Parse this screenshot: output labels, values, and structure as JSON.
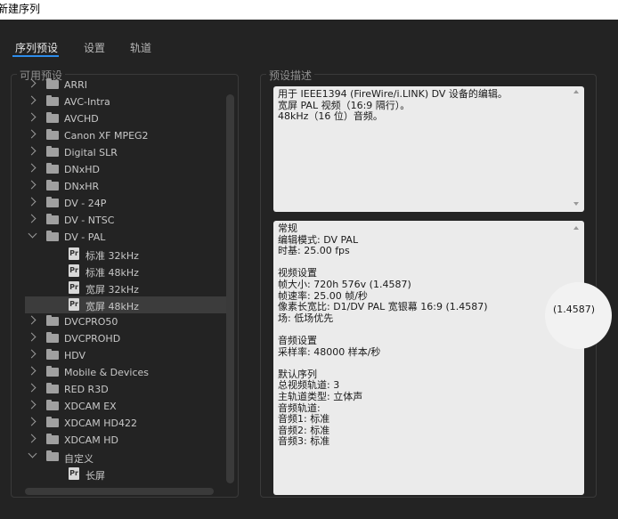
{
  "window": {
    "title": "新建序列"
  },
  "tabs": [
    {
      "label": "序列预设",
      "active": true
    },
    {
      "label": "设置",
      "active": false
    },
    {
      "label": "轨道",
      "active": false
    }
  ],
  "presets_panel": {
    "title": "可用预设",
    "items": [
      {
        "label": "ARRI",
        "type": "folder",
        "expanded": false
      },
      {
        "label": "AVC-Intra",
        "type": "folder",
        "expanded": false
      },
      {
        "label": "AVCHD",
        "type": "folder",
        "expanded": false
      },
      {
        "label": "Canon XF MPEG2",
        "type": "folder",
        "expanded": false
      },
      {
        "label": "Digital SLR",
        "type": "folder",
        "expanded": false
      },
      {
        "label": "DNxHD",
        "type": "folder",
        "expanded": false
      },
      {
        "label": "DNxHR",
        "type": "folder",
        "expanded": false
      },
      {
        "label": "DV - 24P",
        "type": "folder",
        "expanded": false
      },
      {
        "label": "DV - NTSC",
        "type": "folder",
        "expanded": false
      },
      {
        "label": "DV - PAL",
        "type": "folder",
        "expanded": true
      },
      {
        "label": "标准 32kHz",
        "type": "file",
        "selected": false
      },
      {
        "label": "标准 48kHz",
        "type": "file",
        "selected": false
      },
      {
        "label": "宽屏 32kHz",
        "type": "file",
        "selected": false
      },
      {
        "label": "宽屏 48kHz",
        "type": "file",
        "selected": true
      },
      {
        "label": "DVCPRO50",
        "type": "folder",
        "expanded": false
      },
      {
        "label": "DVCPROHD",
        "type": "folder",
        "expanded": false
      },
      {
        "label": "HDV",
        "type": "folder",
        "expanded": false
      },
      {
        "label": "Mobile & Devices",
        "type": "folder",
        "expanded": false
      },
      {
        "label": "RED R3D",
        "type": "folder",
        "expanded": false
      },
      {
        "label": "XDCAM EX",
        "type": "folder",
        "expanded": false
      },
      {
        "label": "XDCAM HD422",
        "type": "folder",
        "expanded": false
      },
      {
        "label": "XDCAM HD",
        "type": "folder",
        "expanded": false
      },
      {
        "label": "自定义",
        "type": "folder",
        "expanded": true
      },
      {
        "label": "长屏",
        "type": "file",
        "selected": false
      }
    ],
    "file_icon_text": "Pr"
  },
  "description_panel": {
    "title": "预设描述",
    "summary_lines": [
      "用于 IEEE1394 (FireWire/i.LINK) DV 设备的编辑。",
      "宽屏 PAL 视频（16:9 隔行）。",
      "48kHz（16 位）音频。"
    ],
    "details_lines": [
      "常规",
      " 编辑模式: DV PAL",
      " 时基: 25.00 fps",
      "",
      "视频设置",
      " 帧大小: 720h 576v (1.4587)",
      " 帧速率: 25.00  帧/秒",
      " 像素长宽比: D1/DV PAL 宽银幕 16:9 (1.4587)",
      " 场: 低场优先",
      "",
      "音频设置",
      " 采样率: 48000 样本/秒",
      "",
      "默认序列",
      " 总视频轨道: 3",
      " 主轨道类型: 立体声",
      " 音频轨道:",
      " 音频1: 标准",
      " 音频2: 标准",
      " 音频3: 标准"
    ],
    "magnified_text": "(1.4587)"
  },
  "colors": {
    "accent": "#2d8ceb",
    "background": "#232323",
    "selected_row": "#3c3c3c"
  }
}
